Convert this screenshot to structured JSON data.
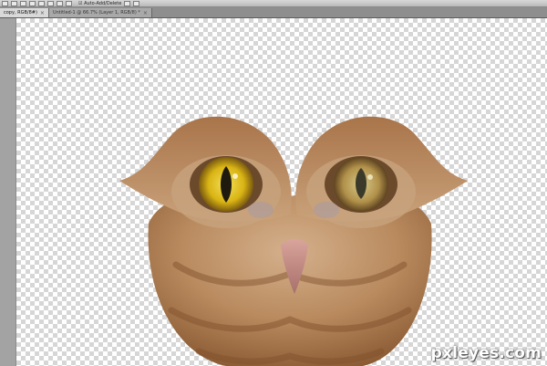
{
  "toolbar": {
    "checkbox_label": "Auto-Add/Delete",
    "icons": [
      "pen-tool-icon",
      "freeform-pen-icon",
      "shape-rect-icon",
      "shape-rounded-icon",
      "shape-ellipse-icon",
      "shape-polygon-icon",
      "shape-line-icon",
      "custom-shape-icon",
      "path-mode-icon",
      "path-add-icon"
    ]
  },
  "tabs": [
    {
      "label": "copy, RGB/8#)",
      "active": true
    },
    {
      "label": "Untitled-1 @ 66.7% (Layer 1, RGB/8) *",
      "active": false
    }
  ],
  "canvas": {
    "watermark": "pxleyes.com",
    "colors": {
      "fur_light": "#c9a27a",
      "fur_dark": "#8a5a33",
      "left_eye": "#e5c21a",
      "right_eye": "#b99a4e",
      "beak": "#c98b85"
    }
  }
}
